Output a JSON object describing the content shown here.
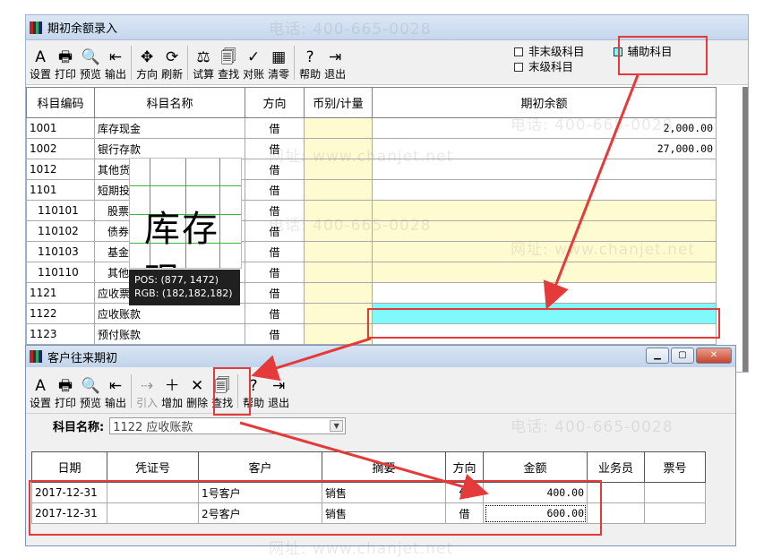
{
  "win1": {
    "title": "期初余额录入",
    "toolbar": [
      {
        "label": "设置",
        "icon": "A",
        "name": "settings-button"
      },
      {
        "label": "打印",
        "icon": "🖶",
        "name": "print-button"
      },
      {
        "label": "预览",
        "icon": "🔍",
        "name": "preview-button"
      },
      {
        "label": "输出",
        "icon": "⇤",
        "name": "export-button"
      },
      {
        "label": "方向",
        "icon": "✥",
        "name": "direction-button"
      },
      {
        "label": "刷新",
        "icon": "⟳",
        "name": "refresh-button"
      },
      {
        "label": "试算",
        "icon": "⚖",
        "name": "trial-balance-button"
      },
      {
        "label": "查找",
        "icon": "🗐",
        "name": "find-button"
      },
      {
        "label": "对账",
        "icon": "✓",
        "name": "reconcile-button"
      },
      {
        "label": "清零",
        "icon": "▦",
        "name": "clear-button"
      },
      {
        "label": "帮助",
        "icon": "?",
        "name": "help-button"
      },
      {
        "label": "退出",
        "icon": "⇥",
        "name": "exit-button"
      }
    ],
    "legend": {
      "non_leaf": "非末级科目",
      "leaf": "末级科目",
      "aux": "辅助科目"
    },
    "headers": {
      "code": "科目编码",
      "name": "科目名称",
      "dir": "方向",
      "currency": "币别/计量",
      "balance": "期初余额"
    },
    "rows": [
      {
        "code": "1001",
        "name": "库存现金",
        "dir": "借",
        "balance": "2,000.00",
        "style": "w"
      },
      {
        "code": "1002",
        "name": "银行存款",
        "dir": "借",
        "balance": "27,000.00",
        "style": "w"
      },
      {
        "code": "1012",
        "name": "其他货币资金",
        "dir": "借",
        "balance": "",
        "style": "w"
      },
      {
        "code": "1101",
        "name": "短期投资",
        "dir": "借",
        "balance": "",
        "style": "w"
      },
      {
        "code": "110101",
        "name": "股票",
        "dir": "借",
        "balance": "",
        "style": "y"
      },
      {
        "code": "110102",
        "name": "债券",
        "dir": "借",
        "balance": "",
        "style": "y"
      },
      {
        "code": "110103",
        "name": "基金",
        "dir": "借",
        "balance": "",
        "style": "y"
      },
      {
        "code": "110110",
        "name": "其他",
        "dir": "借",
        "balance": "",
        "style": "y"
      },
      {
        "code": "1121",
        "name": "应收票据",
        "dir": "借",
        "balance": "",
        "style": "w"
      },
      {
        "code": "1122",
        "name": "应收账款",
        "dir": "借",
        "balance": "",
        "style": "c"
      },
      {
        "code": "1123",
        "name": "预付账款",
        "dir": "借",
        "balance": "",
        "style": "w"
      }
    ]
  },
  "magnifier": {
    "text": "库存现",
    "pos": "POS: (877, 1472)",
    "rgb": "RGB: (182,182,182)"
  },
  "win2": {
    "title": "客户往来期初",
    "toolbar": [
      {
        "label": "设置",
        "icon": "A",
        "name": "settings-button-2",
        "disabled": false
      },
      {
        "label": "打印",
        "icon": "🖶",
        "name": "print-button-2",
        "disabled": false
      },
      {
        "label": "预览",
        "icon": "🔍",
        "name": "preview-button-2",
        "disabled": false
      },
      {
        "label": "输出",
        "icon": "⇤",
        "name": "export-button-2",
        "disabled": false
      },
      {
        "label": "引入",
        "icon": "⇢",
        "name": "import-button",
        "disabled": true
      },
      {
        "label": "增加",
        "icon": "＋",
        "name": "add-button",
        "disabled": false
      },
      {
        "label": "删除",
        "icon": "✕",
        "name": "delete-button",
        "disabled": false
      },
      {
        "label": "查找",
        "icon": "🗐",
        "name": "find-button-2",
        "disabled": false
      },
      {
        "label": "帮助",
        "icon": "?",
        "name": "help-button-2",
        "disabled": false
      },
      {
        "label": "退出",
        "icon": "⇥",
        "name": "exit-button-2",
        "disabled": false
      }
    ],
    "subject_label": "科目名称:",
    "subject_value": "1122 应收账款",
    "headers": {
      "date": "日期",
      "voucher": "凭证号",
      "customer": "客户",
      "summary": "摘要",
      "dir": "方向",
      "amount": "金额",
      "staff": "业务员",
      "ticket": "票号"
    },
    "rows": [
      {
        "date": "2017-12-31",
        "voucher": "",
        "customer": "1号客户",
        "summary": "销售",
        "dir": "借",
        "amount": "400.00"
      },
      {
        "date": "2017-12-31",
        "voucher": "",
        "customer": "2号客户",
        "summary": "销售",
        "dir": "借",
        "amount": "600.00"
      }
    ]
  },
  "watermark": {
    "phone": "电话: 400-665-0028",
    "site": "网址: www.chanjet.net"
  },
  "colors": {
    "annotation_red": "#e53a3a",
    "aux_cyan": "#7ff9fb",
    "leaf_yellow": "#fffbd0"
  }
}
